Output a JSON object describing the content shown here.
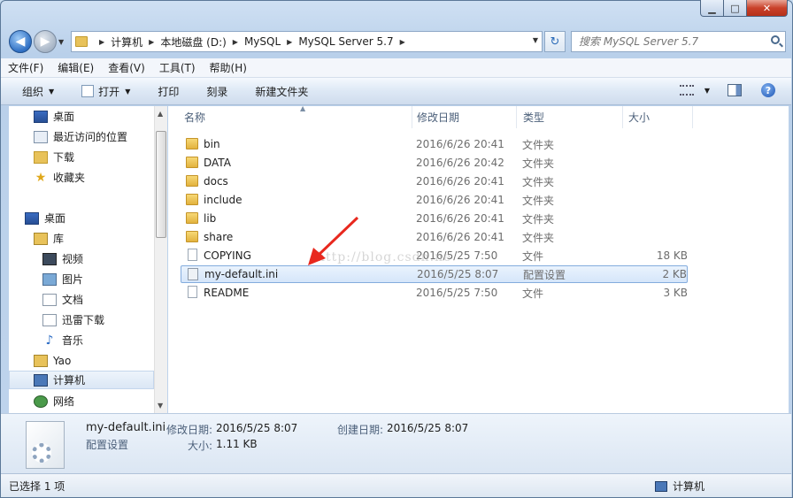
{
  "window": {
    "minimize": "▁",
    "maximize": "□",
    "close": "✕"
  },
  "nav": {
    "back": "◀",
    "forward": "▶",
    "breadcrumb": [
      "计算机",
      "本地磁盘 (D:)",
      "MySQL",
      "MySQL Server 5.7"
    ],
    "search_placeholder": "搜索 MySQL Server 5.7"
  },
  "menu": [
    "文件(F)",
    "编辑(E)",
    "查看(V)",
    "工具(T)",
    "帮助(H)"
  ],
  "toolbar": {
    "organize": "组织",
    "open": "打开",
    "print": "打印",
    "burn": "刻录",
    "new_folder": "新建文件夹"
  },
  "sidebar": {
    "items": [
      {
        "label": "桌面",
        "icon": "desktop-icon"
      },
      {
        "label": "最近访问的位置",
        "icon": "recent-places-icon"
      },
      {
        "label": "下载",
        "icon": "downloads-icon"
      },
      {
        "label": "收藏夹",
        "icon": "favorites-star-icon"
      },
      {
        "label": "桌面",
        "icon": "desktop-icon"
      },
      {
        "label": "库",
        "icon": "libraries-icon"
      },
      {
        "label": "视频",
        "icon": "video-icon"
      },
      {
        "label": "图片",
        "icon": "pictures-icon"
      },
      {
        "label": "文档",
        "icon": "documents-icon"
      },
      {
        "label": "迅雷下载",
        "icon": "thunder-download-icon"
      },
      {
        "label": "音乐",
        "icon": "music-icon"
      },
      {
        "label": "Yao",
        "icon": "user-folder-icon"
      },
      {
        "label": "计算机",
        "icon": "computer-icon"
      },
      {
        "label": "网络",
        "icon": "network-icon"
      }
    ]
  },
  "list": {
    "columns": [
      "名称",
      "修改日期",
      "类型",
      "大小"
    ],
    "rows": [
      {
        "name": "bin",
        "date": "2016/6/26 20:41",
        "type": "文件夹",
        "size": "",
        "icon": "folder-icon"
      },
      {
        "name": "DATA",
        "date": "2016/6/26 20:42",
        "type": "文件夹",
        "size": "",
        "icon": "folder-icon"
      },
      {
        "name": "docs",
        "date": "2016/6/26 20:41",
        "type": "文件夹",
        "size": "",
        "icon": "folder-icon"
      },
      {
        "name": "include",
        "date": "2016/6/26 20:41",
        "type": "文件夹",
        "size": "",
        "icon": "folder-icon"
      },
      {
        "name": "lib",
        "date": "2016/6/26 20:41",
        "type": "文件夹",
        "size": "",
        "icon": "folder-icon"
      },
      {
        "name": "share",
        "date": "2016/6/26 20:41",
        "type": "文件夹",
        "size": "",
        "icon": "folder-icon"
      },
      {
        "name": "COPYING",
        "date": "2016/5/25 7:50",
        "type": "文件",
        "size": "18 KB",
        "icon": "file-icon"
      },
      {
        "name": "my-default.ini",
        "date": "2016/5/25 8:07",
        "type": "配置设置",
        "size": "2 KB",
        "icon": "ini-file-icon"
      },
      {
        "name": "README",
        "date": "2016/5/25 7:50",
        "type": "文件",
        "size": "3 KB",
        "icon": "file-icon"
      }
    ]
  },
  "watermark": "http://blog.csdn.ne",
  "details": {
    "filename": "my-default.ini",
    "filetype": "配置设置",
    "modified_label": "修改日期:",
    "modified_value": "2016/5/25 8:07",
    "created_label": "创建日期:",
    "created_value": "2016/5/25 8:07",
    "size_label": "大小:",
    "size_value": "1.11 KB"
  },
  "status": {
    "selected": "已选择 1 项",
    "location": "计算机"
  },
  "colors": {
    "accent": "#3a6cc2",
    "selection": "#d5e6fa",
    "annotation_arrow": "#e8281e"
  }
}
